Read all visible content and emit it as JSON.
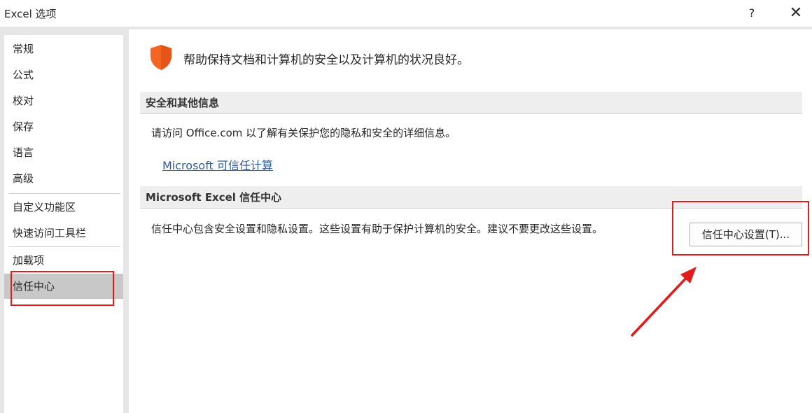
{
  "window": {
    "title": "Excel 选项",
    "help_symbol": "?",
    "close_symbol": "✕"
  },
  "sidebar": {
    "items": [
      {
        "label": "常规"
      },
      {
        "label": "公式"
      },
      {
        "label": "校对"
      },
      {
        "label": "保存"
      },
      {
        "label": "语言"
      },
      {
        "label": "高级"
      },
      {
        "label": "自定义功能区"
      },
      {
        "label": "快速访问工具栏"
      },
      {
        "label": "加载项"
      },
      {
        "label": "信任中心",
        "selected": true
      }
    ]
  },
  "main": {
    "intro": "帮助保持文档和计算机的安全以及计算机的状况良好。",
    "shield_icon": "shield-icon",
    "accent_color": "#f26522",
    "sections": [
      {
        "heading": "安全和其他信息",
        "text": "请访问 Office.com 以了解有关保护您的隐私和安全的详细信息。",
        "link": "Microsoft 可信任计算"
      },
      {
        "heading": "Microsoft Excel 信任中心",
        "text": "信任中心包含安全设置和隐私设置。这些设置有助于保护计算机的安全。建议不要更改这些设置。",
        "button": "信任中心设置(T)..."
      }
    ]
  },
  "annotation_color": "#e21b1b"
}
